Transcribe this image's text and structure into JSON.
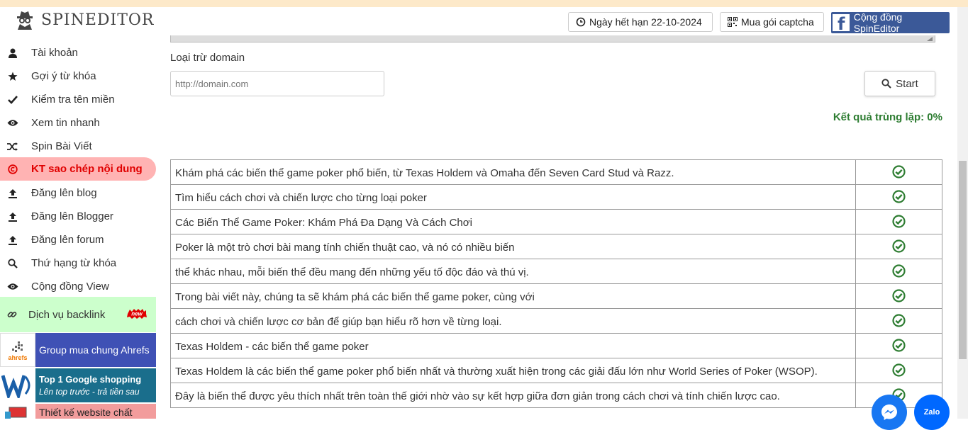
{
  "header": {
    "logo_text": "SPINEDITOR",
    "expiry_label": "Ngày hết hạn 22-10-2024",
    "captcha_label": "Mua gói captcha",
    "facebook_label": "Cộng đồng SpinEditor"
  },
  "sidebar": {
    "items": [
      {
        "label": "Tài khoản",
        "icon": "user-icon"
      },
      {
        "label": "Gợi ý từ khóa",
        "icon": "star-icon"
      },
      {
        "label": "Kiểm tra tên miền",
        "icon": "check-icon"
      },
      {
        "label": "Xem tin nhanh",
        "icon": "eye-icon"
      },
      {
        "label": "Spin Bài Viết",
        "icon": "shuffle-icon"
      },
      {
        "label": "KT sao chép nội dung",
        "icon": "copyright-icon"
      },
      {
        "label": "Đăng lên blog",
        "icon": "upload-icon"
      },
      {
        "label": "Đăng lên Blogger",
        "icon": "upload-icon"
      },
      {
        "label": "Đăng lên forum",
        "icon": "upload-icon"
      },
      {
        "label": "Thứ hạng từ khóa",
        "icon": "search-icon"
      },
      {
        "label": "Cộng đồng View",
        "icon": "eye-icon"
      }
    ],
    "backlink_label": "Dịch vụ backlink",
    "new_badge": "new",
    "banners": {
      "ahrefs_label": "Group mua chung Ahrefs",
      "ahrefs_logo": "ahrefs",
      "google_title": "Top 1 Google shopping",
      "google_sub": "Lên top trước - trả tiền sau",
      "web_label": "Thiết kế website chất"
    }
  },
  "main": {
    "exclude_label": "Loại trừ domain",
    "domain_placeholder": "http://domain.com",
    "start_label": "Start",
    "result_label": "Kết quả trùng lặp: 0%",
    "rows": [
      "Khám phá các biến thể game poker phổ biến, từ Texas Holdem và Omaha đến Seven Card Stud và Razz.",
      "Tìm hiểu cách chơi và chiến lược cho từng loại poker",
      "Các Biến Thể Game Poker: Khám Phá Đa Dạng Và Cách Chơi",
      "Poker là một trò chơi bài mang tính chiến thuật cao, và nó có nhiều biến",
      "thể khác nhau, mỗi biến thể đều mang đến những yếu tố độc đáo và thú vị.",
      "Trong bài viết này, chúng ta sẽ khám phá các biến thể game poker, cùng với",
      "cách chơi và chiến lược cơ bản để giúp bạn hiểu rõ hơn về từng loại.",
      "Texas Holdem - các biến thể game poker",
      "Texas Holdem là các biến thể game poker phổ biến nhất và thường xuất hiện trong các giải đấu lớn như World Series of Poker (WSOP).",
      "Đây là biến thể được yêu thích nhất trên toàn thế giới nhờ vào sự kết hợp giữa đơn giản trong cách chơi và tính chiến lược cao."
    ]
  },
  "zalo_label": "Zalo",
  "colors": {
    "accent_green": "#2e7d32",
    "active_red": "#e00000",
    "facebook_blue": "#3b5998"
  }
}
